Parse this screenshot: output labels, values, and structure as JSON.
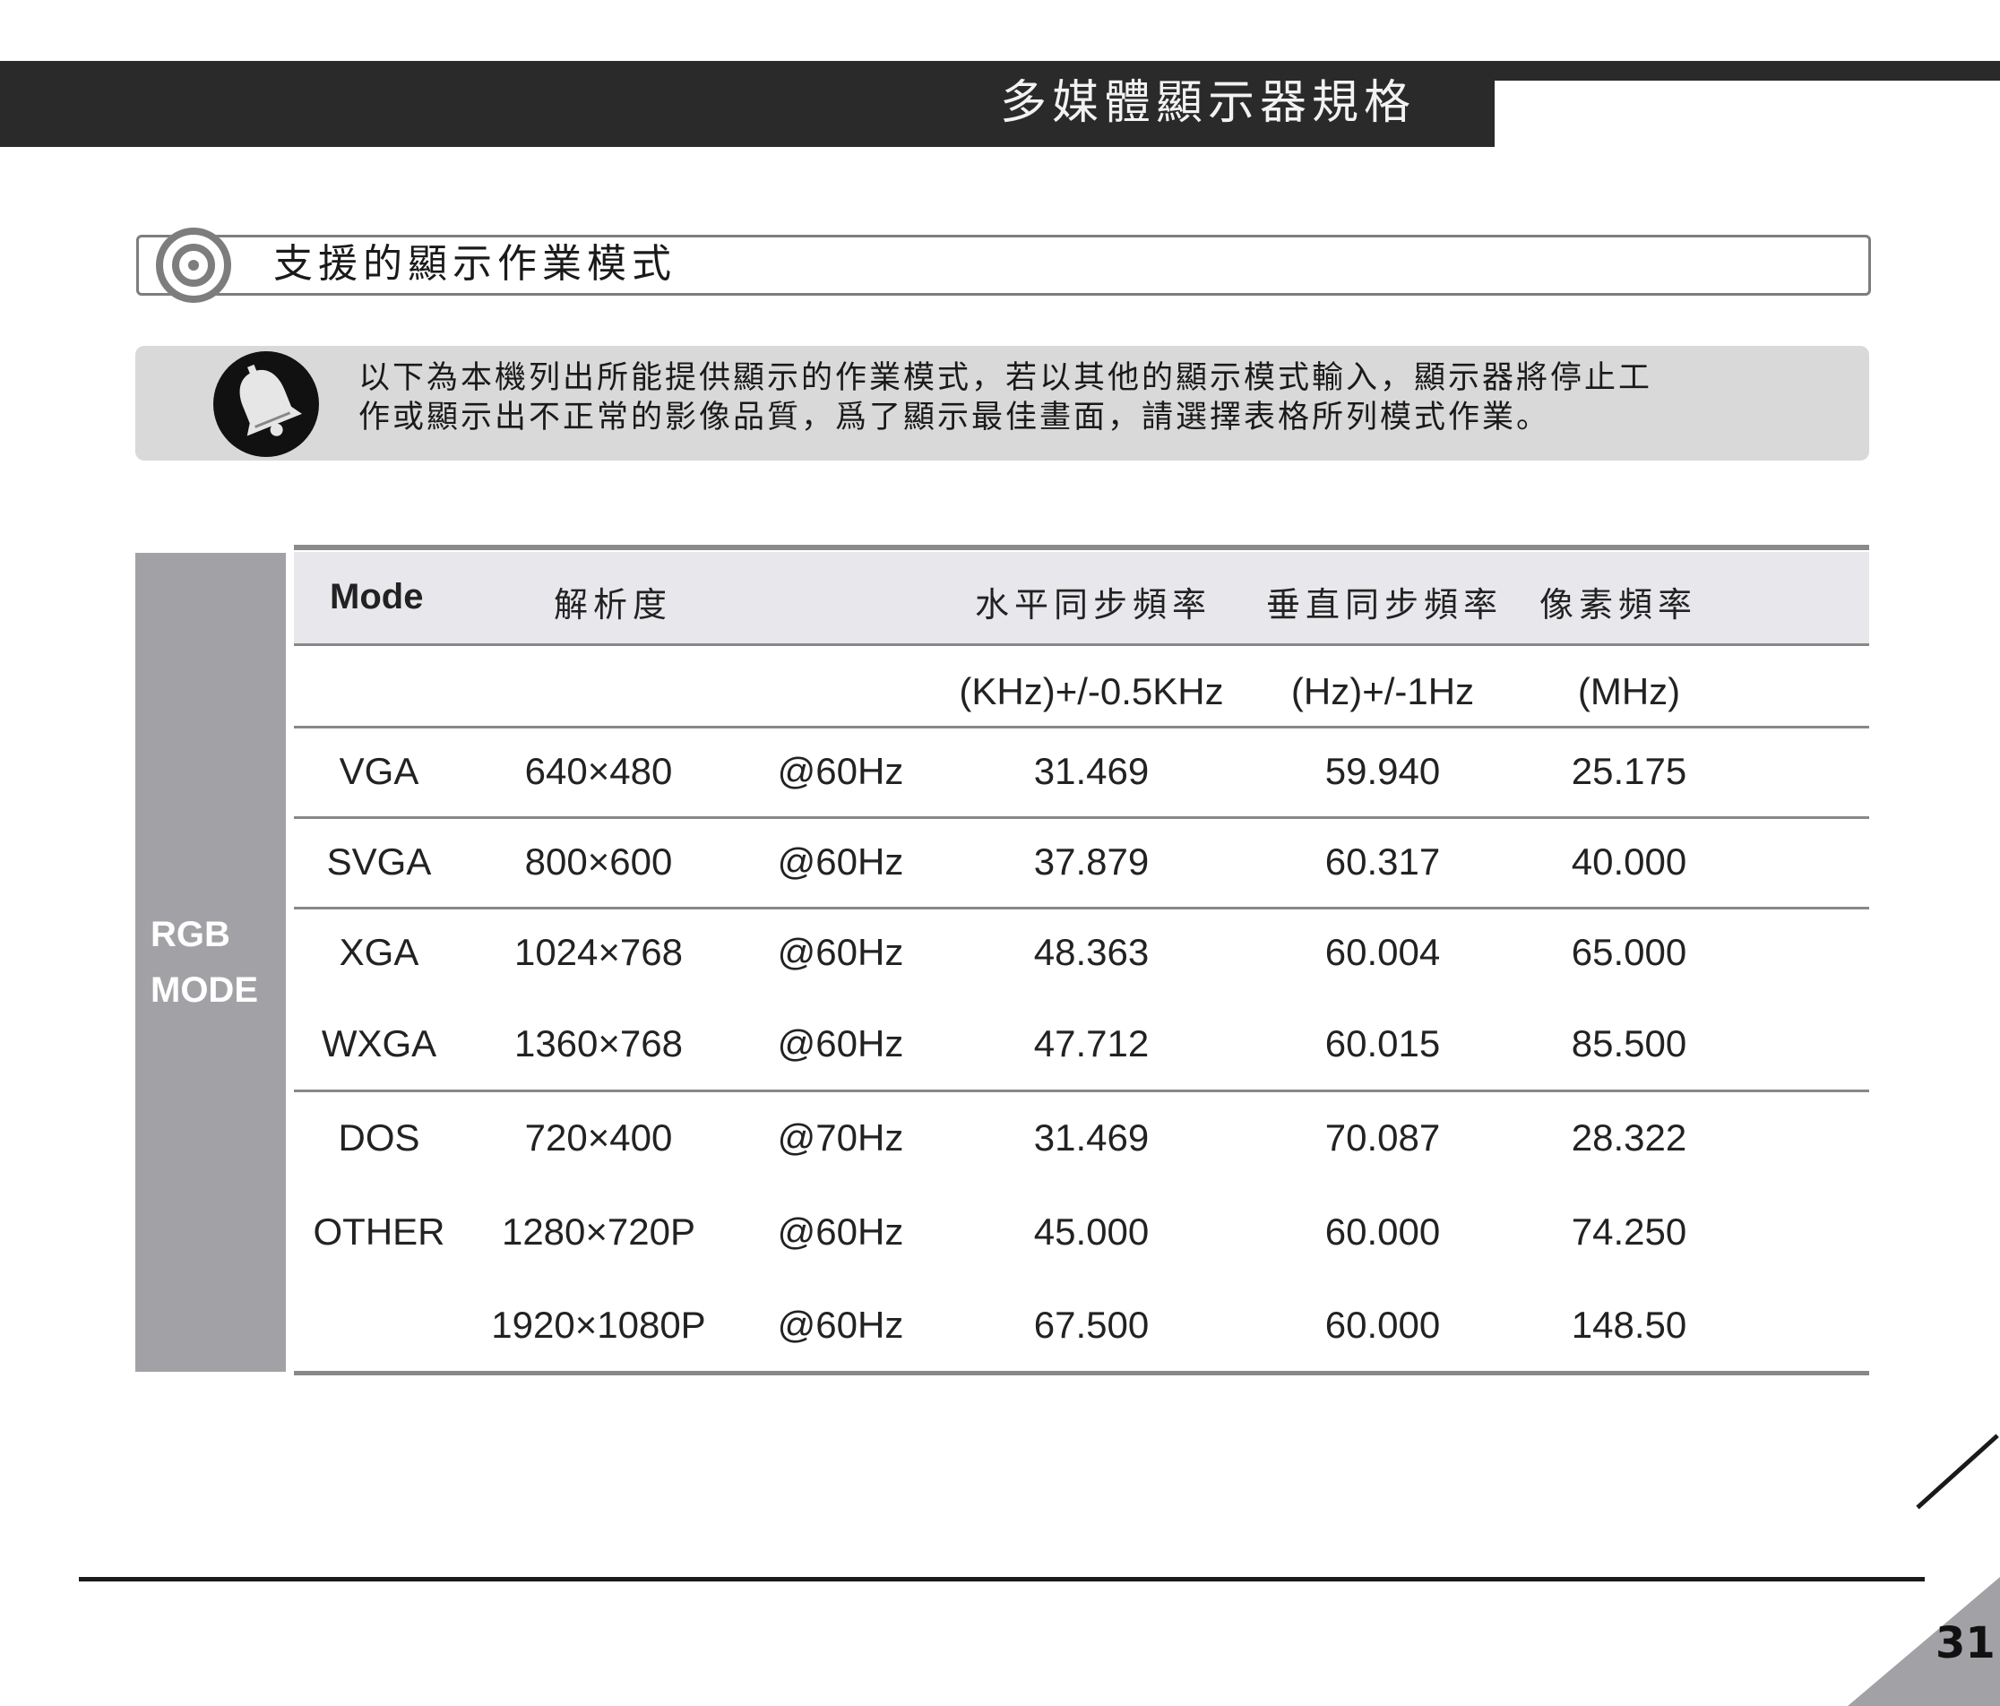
{
  "header": {
    "title": "多媒體顯示器規格"
  },
  "section": {
    "title": "支援的顯示作業模式"
  },
  "notice": {
    "line1": "以下為本機列出所能提供顯示的作業模式，若以其他的顯示模式輸入，顯示器將停止工",
    "line2": "作或顯示出不正常的影像品質，爲了顯示最佳畫面，請選擇表格所列模式作業。"
  },
  "side_label": {
    "line1": "RGB",
    "line2": "MODE"
  },
  "table": {
    "headers": {
      "mode": "Mode",
      "resolution": "解析度",
      "hsync": "水平同步頻率",
      "vsync": "垂直同步頻率",
      "pixel": "像素頻率"
    },
    "units": {
      "hsync": "(KHz)+/-0.5KHz",
      "vsync": "(Hz)+/-1Hz",
      "pixel": "(MHz)"
    },
    "rows": [
      {
        "mode": "VGA",
        "resolution": "640×480",
        "refresh": "@60Hz",
        "hsync": "31.469",
        "vsync": "59.940",
        "pixel": "25.175"
      },
      {
        "mode": "SVGA",
        "resolution": "800×600",
        "refresh": "@60Hz",
        "hsync": "37.879",
        "vsync": "60.317",
        "pixel": "40.000"
      },
      {
        "mode": "XGA",
        "resolution": "1024×768",
        "refresh": "@60Hz",
        "hsync": "48.363",
        "vsync": "60.004",
        "pixel": "65.000"
      },
      {
        "mode": "WXGA",
        "resolution": "1360×768",
        "refresh": "@60Hz",
        "hsync": "47.712",
        "vsync": "60.015",
        "pixel": "85.500"
      },
      {
        "mode": "DOS",
        "resolution": "720×400",
        "refresh": "@70Hz",
        "hsync": "31.469",
        "vsync": "70.087",
        "pixel": "28.322"
      },
      {
        "mode": "OTHER",
        "resolution": "1280×720P",
        "refresh": "@60Hz",
        "hsync": "45.000",
        "vsync": "60.000",
        "pixel": "74.250"
      },
      {
        "mode": "",
        "resolution": "1920×1080P",
        "refresh": "@60Hz",
        "hsync": "67.500",
        "vsync": "60.000",
        "pixel": "148.50"
      }
    ]
  },
  "footer": {
    "page_number": "31"
  },
  "colors": {
    "dark": "#2a2a2a",
    "gray": "#a2a2a6",
    "light": "#d9d9d9"
  }
}
